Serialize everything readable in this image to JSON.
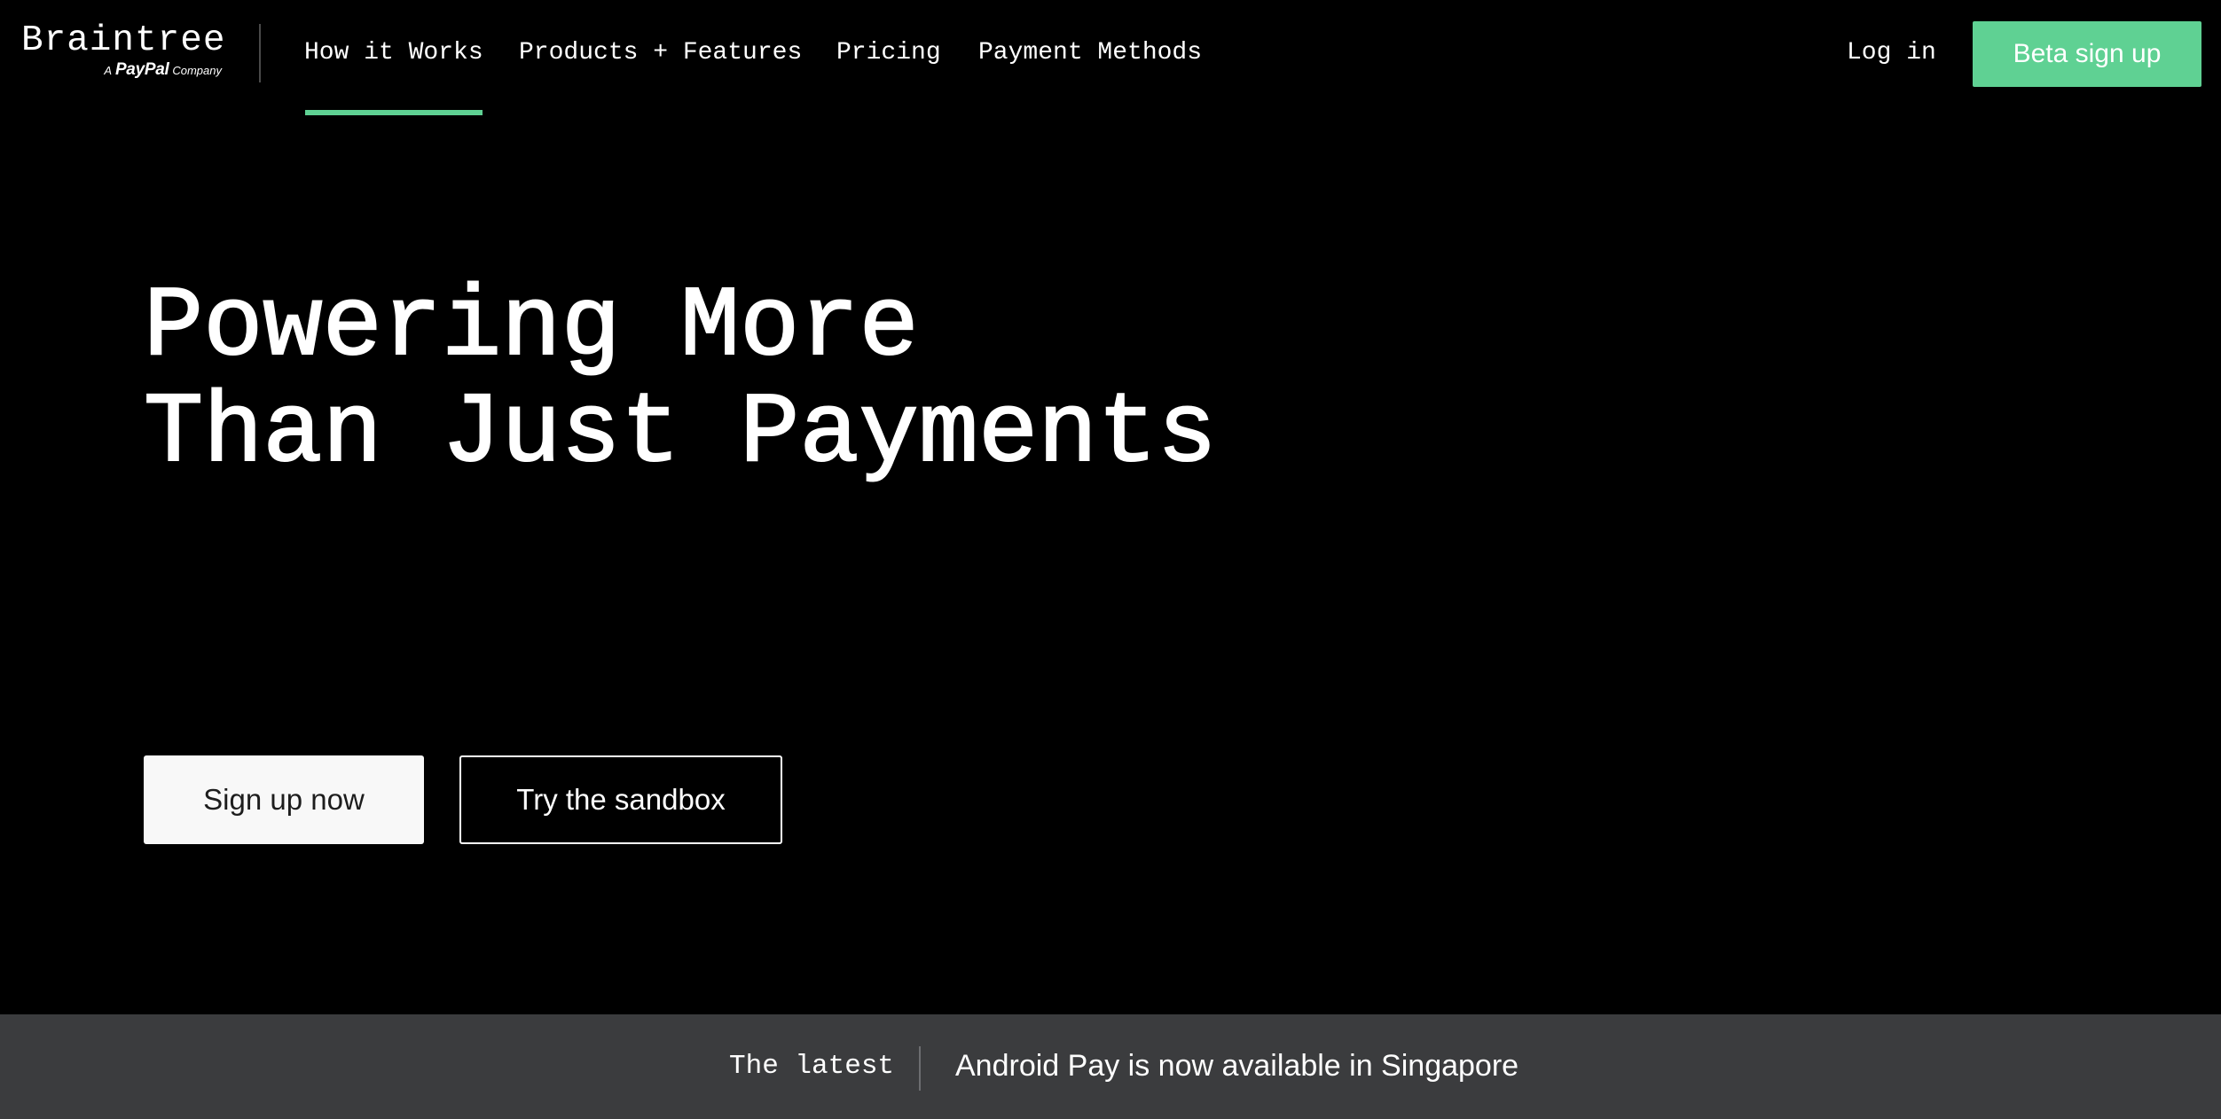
{
  "brand": {
    "name": "Braintree",
    "tagline_prefix": "A",
    "tagline_brand": "PayPal",
    "tagline_suffix": "Company"
  },
  "nav": {
    "items": [
      {
        "label": "How it Works",
        "active": true
      },
      {
        "label": "Products + Features",
        "active": false
      },
      {
        "label": "Pricing",
        "active": false
      },
      {
        "label": "Payment Methods",
        "active": false
      }
    ]
  },
  "header_actions": {
    "login_label": "Log in",
    "beta_label": "Beta sign up"
  },
  "hero": {
    "title_line1": "Powering More",
    "title_line2": "Than Just Payments",
    "primary_button": "Sign up now",
    "secondary_button": "Try the sandbox"
  },
  "announcement": {
    "label": "The latest",
    "text": "Android Pay is now available in Singapore"
  },
  "colors": {
    "background": "#000000",
    "accent": "#5fd193",
    "announcement_bar": "#3b3c3e",
    "primary_button_bg": "#f8f8f8"
  }
}
